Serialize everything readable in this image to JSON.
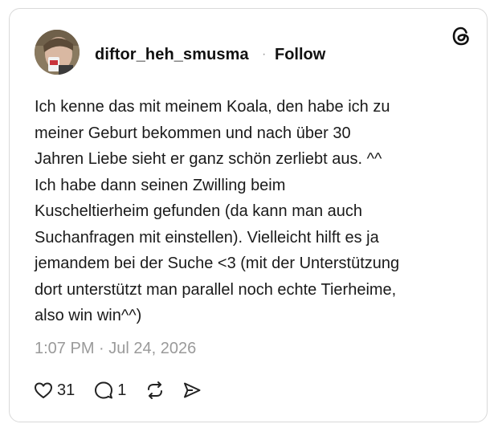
{
  "post": {
    "username": "diftor_heh_smusma",
    "separator": "·",
    "follow_label": "Follow",
    "text": "Ich kenne das mit meinem Koala, den habe ich zu\nmeiner Geburt bekommen und nach über 30\nJahren Liebe sieht er ganz schön zerliebt aus. ^^\nIch habe dann seinen Zwilling beim\nKuscheltierheim gefunden (da kann man auch\nSuchanfragen mit einstellen). Vielleicht hilft es ja\njemandem bei der Suche <3 (mit der Unterstützung\ndort unterstützt man parallel noch echte Tierheime,\nalso win win^^)",
    "timestamp": "1:07 PM · Jul 24, 2026",
    "likes": "31",
    "replies": "1"
  },
  "icons": {
    "brand": "threads-logo-icon",
    "like": "heart-icon",
    "reply": "comment-icon",
    "repost": "repost-icon",
    "share": "share-icon"
  },
  "colors": {
    "text": "#1a1a1a",
    "muted": "#9a9a9a",
    "border": "#d9d9d9"
  }
}
